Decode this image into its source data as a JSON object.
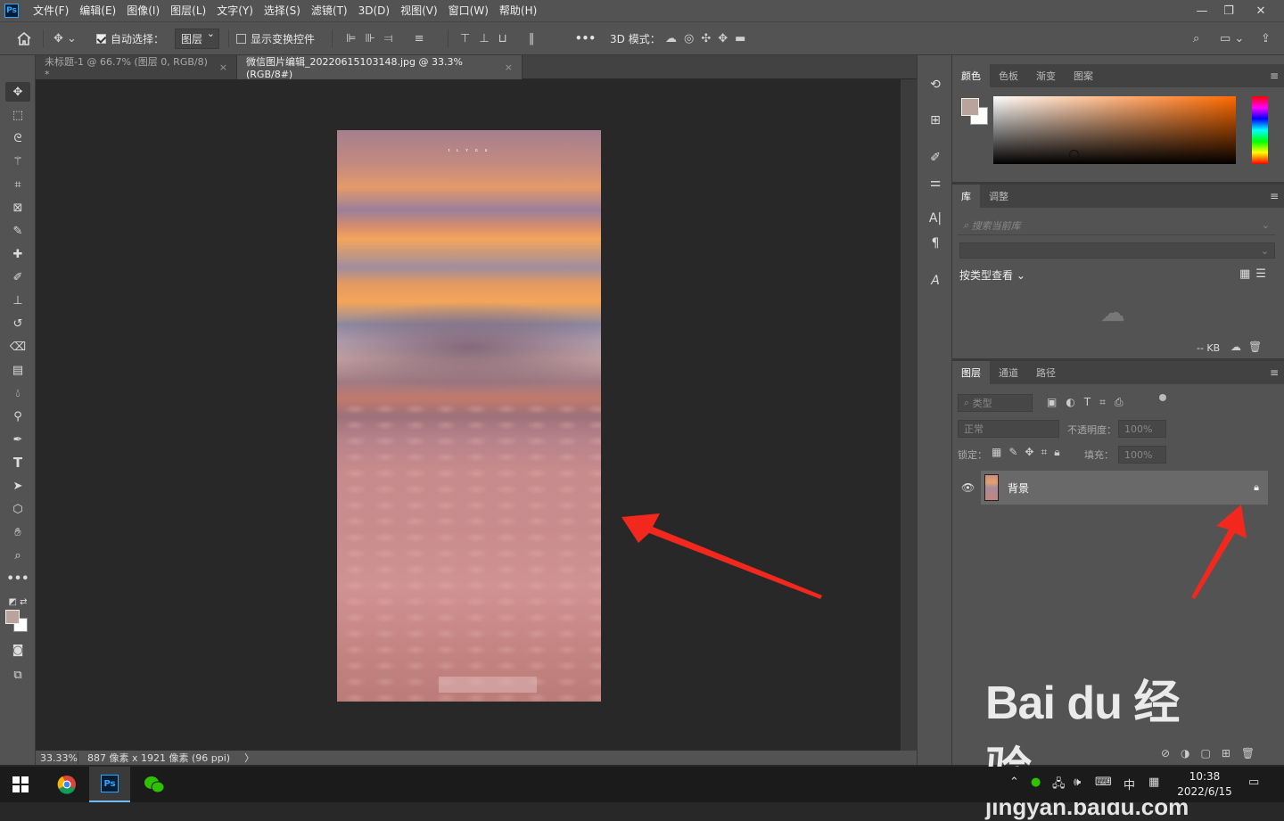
{
  "app": {
    "logo": "Ps"
  },
  "menu": [
    "文件(F)",
    "编辑(E)",
    "图像(I)",
    "图层(L)",
    "文字(Y)",
    "选择(S)",
    "滤镜(T)",
    "3D(D)",
    "视图(V)",
    "窗口(W)",
    "帮助(H)"
  ],
  "window_controls": {
    "minimize": "—",
    "restore": "❐",
    "close": "✕"
  },
  "options": {
    "auto_select_label": "自动选择：",
    "auto_select_checked": true,
    "auto_select_target": "图层",
    "show_transform_label": "显示变换控件",
    "show_transform_checked": false,
    "more": "•••",
    "mode_3d_label": "3D 模式："
  },
  "doc_tabs": [
    {
      "title": "未标题-1 @ 66.7% (图层 0, RGB/8) *",
      "close": "×",
      "active": false
    },
    {
      "title": "微信图片编辑_20220615103148.jpg @ 33.3%(RGB/8#)",
      "close": "×",
      "active": true
    }
  ],
  "canvas": {
    "image_caption": "ɪ ʟ ʏ ɢ ᴜ"
  },
  "status": {
    "zoom": "33.33%",
    "info": "887 像素 x 1921 像素 (96 ppi)",
    "arrow": "〉"
  },
  "color_panel": {
    "tabs": [
      "颜色",
      "色板",
      "渐变",
      "图案"
    ],
    "foreground": "#b9a39b",
    "background": "#ffffff",
    "picker_hue": "#ff6a00"
  },
  "library_panel": {
    "tabs": [
      "库",
      "调整"
    ],
    "search_placeholder": "搜索当前库",
    "view_label": "按类型查看",
    "size": "-- KB"
  },
  "layers_panel": {
    "tabs": [
      "图层",
      "通道",
      "路径"
    ],
    "filter_kind": "类型",
    "blend_mode": "正常",
    "opacity_label": "不透明度：",
    "opacity_value": "100%",
    "lock_label": "锁定：",
    "fill_label": "填充：",
    "fill_value": "100%",
    "layers": [
      {
        "name": "背景",
        "visible": true,
        "locked": true
      }
    ]
  },
  "watermark": {
    "line1": "Bai du 经验",
    "line2": "jingyan.baidu.com"
  },
  "taskbar": {
    "ime": "中",
    "time": "10:38",
    "date": "2022/6/15"
  },
  "colors": {
    "ui_panel": "#535353",
    "canvas_bg": "#282828",
    "arrow_red": "#f2281e",
    "accent": "#31a8ff"
  }
}
